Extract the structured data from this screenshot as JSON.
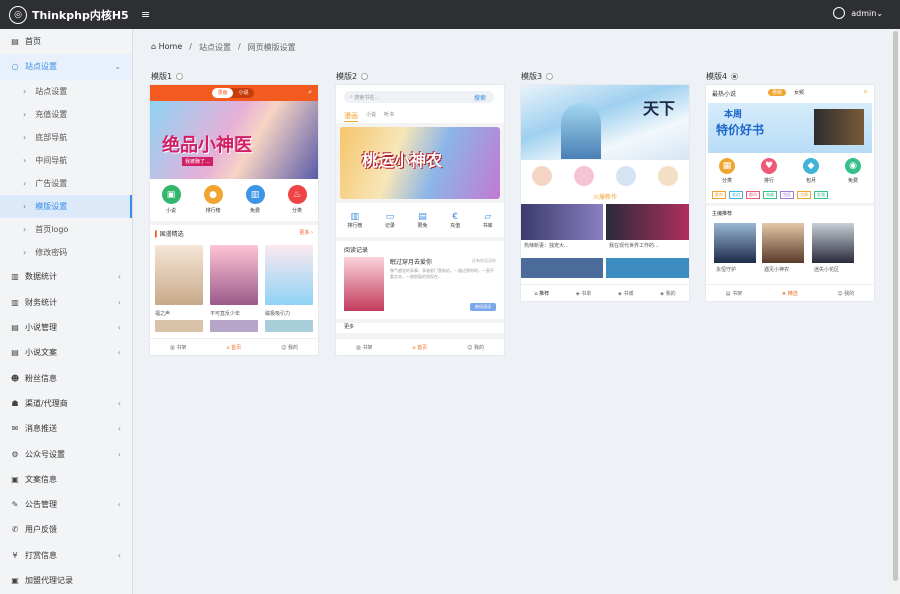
{
  "app": {
    "title": "Thinkphp内核H5",
    "user": "admin"
  },
  "sidebar": {
    "top": [
      {
        "label": "首页"
      },
      {
        "label": "站点设置"
      }
    ],
    "sub": [
      {
        "label": "站点设置"
      },
      {
        "label": "充值设置"
      },
      {
        "label": "底部导航"
      },
      {
        "label": "中间导航"
      },
      {
        "label": "广告设置"
      },
      {
        "label": "模版设置"
      },
      {
        "label": "首页logo"
      },
      {
        "label": "修改密码"
      }
    ],
    "rest": [
      {
        "label": "数据统计",
        "arrow": true
      },
      {
        "label": "财务统计",
        "arrow": true
      },
      {
        "label": "小说管理",
        "arrow": true
      },
      {
        "label": "小说文案",
        "arrow": true
      },
      {
        "label": "粉丝信息",
        "arrow": false
      },
      {
        "label": "渠道/代理商",
        "arrow": true
      },
      {
        "label": "消息推送",
        "arrow": true
      },
      {
        "label": "公众号设置",
        "arrow": true
      },
      {
        "label": "文案信息",
        "arrow": false
      },
      {
        "label": "公告管理",
        "arrow": true
      },
      {
        "label": "用户反馈",
        "arrow": false
      },
      {
        "label": "打赏信息",
        "arrow": true
      },
      {
        "label": "加盟代理记录",
        "arrow": false
      }
    ]
  },
  "breadcrumb": {
    "home": "Home",
    "sep": "/",
    "level1": "站点设置",
    "level2": "网页模版设置"
  },
  "templates": [
    {
      "label": "模版1",
      "selected": false
    },
    {
      "label": "模版2",
      "selected": false
    },
    {
      "label": "模版3",
      "selected": false
    },
    {
      "label": "模版4",
      "selected": true
    }
  ],
  "t1": {
    "tab_a": "漫画",
    "tab_b": "小说",
    "banner": "绝品小神医",
    "banner_sub": "我被赚了...",
    "icons": [
      "小说",
      "排行榜",
      "免费",
      "分类"
    ],
    "section": "国漫精选",
    "more": "更多 ›",
    "books": [
      "福之声",
      "不可直反少年",
      "磁极吸引力"
    ],
    "tabs": [
      "书架",
      "首页",
      "我的"
    ]
  },
  "t2": {
    "search": "搜索书名...",
    "search_btn": "搜索",
    "cats": [
      "漫画",
      "小说",
      "听书"
    ],
    "banner": "桃运小神农",
    "icons": [
      "排行榜",
      "记录",
      "限免",
      "充值",
      "书库"
    ],
    "reading": "阅读记录",
    "book_title": "眠过穿月去爱你",
    "book_status": "还有你没读的",
    "book_desc": "微气感觉的享事，享者前门我有机，一路边到你的，一直不看文本，一路到面的到现在...",
    "continue": "继续阅读",
    "more": "更多",
    "tabs": [
      "书架",
      "首页",
      "我的"
    ]
  },
  "t3": {
    "title_art": "天下",
    "new_label": "火爆新作",
    "books": [
      "热辣新妻：独宠大...",
      "我在现代世界工作的..."
    ],
    "tabs": [
      "推荐",
      "书单",
      "书城",
      "我的"
    ]
  },
  "t4": {
    "title": "最热小说",
    "tab_a": "男频",
    "tab_b": "女频",
    "banner_a": "本周",
    "banner_b": "特价好书",
    "icons": [
      "分类",
      "排行",
      "包月",
      "免费"
    ],
    "tags": [
      "都市",
      "玄幻",
      "都市",
      "穿越",
      "宫廷",
      "言情",
      "女强"
    ],
    "section": "主编推荐",
    "books": [
      "永恒守护",
      "遇见小神农",
      "迷失小花区"
    ],
    "tabs": [
      "书架",
      "精选",
      "我的"
    ]
  },
  "colors": {
    "accent": "#3a8ee6",
    "orange": "#ef6b24",
    "topbar": "#2d2f33"
  }
}
